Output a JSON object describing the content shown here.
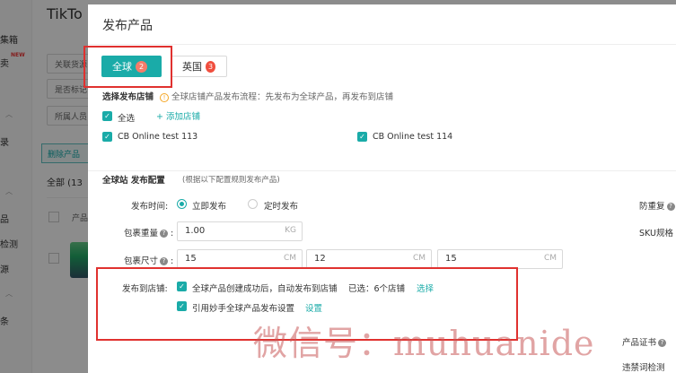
{
  "background": {
    "app_title": "TikTo",
    "sidebar": [
      "集箱",
      "卖",
      "录",
      "品",
      "检测",
      "源",
      "条"
    ],
    "new_badge": "NEW",
    "filters": [
      "关联货源",
      "是否标记",
      "所属人员"
    ],
    "delete_button": "删除产品",
    "all_tab": "全部 (13",
    "product_col": "产品"
  },
  "modal": {
    "title": "发布产品",
    "tabs": [
      {
        "label": "全球",
        "count": "2"
      },
      {
        "label": "英国",
        "count": "3"
      }
    ],
    "select_store": {
      "label": "选择发布店铺",
      "hint": "全球店铺产品发布流程：先发布为全球产品，再发布到店铺",
      "select_all": "全选",
      "add_store": "+ 添加店铺",
      "stores": [
        "CB Online test 113",
        "CB Online test 114"
      ]
    },
    "config": {
      "title": "全球站 发布配置",
      "subtitle": "(根据以下配置规则发布产品)",
      "publish_time_label": "发布时间:",
      "publish_now": "立即发布",
      "publish_scheduled": "定时发布",
      "anti_dup": "防重复",
      "weight_label": "包裹重量",
      "weight_value": "1.00",
      "weight_unit": "KG",
      "sku_spec": "SKU规格",
      "size_label": "包裹尺寸",
      "size_values": [
        "15",
        "12",
        "15"
      ],
      "size_unit": "CM",
      "publish_to_store_label": "发布到店铺:",
      "auto_publish": "全球产品创建成功后，自动发布到店铺",
      "selected": "已选：6个店铺",
      "choose": "选择",
      "quote_settings": "引用妙手全球产品发布设置",
      "settings": "设置",
      "cert": "产品证书",
      "violation": "违禁词检测"
    }
  },
  "watermark": "微信号：muhuanide",
  "colors": {
    "accent": "#1aaba8",
    "badge": "#f04e3e",
    "highlight": "#e0312f"
  }
}
